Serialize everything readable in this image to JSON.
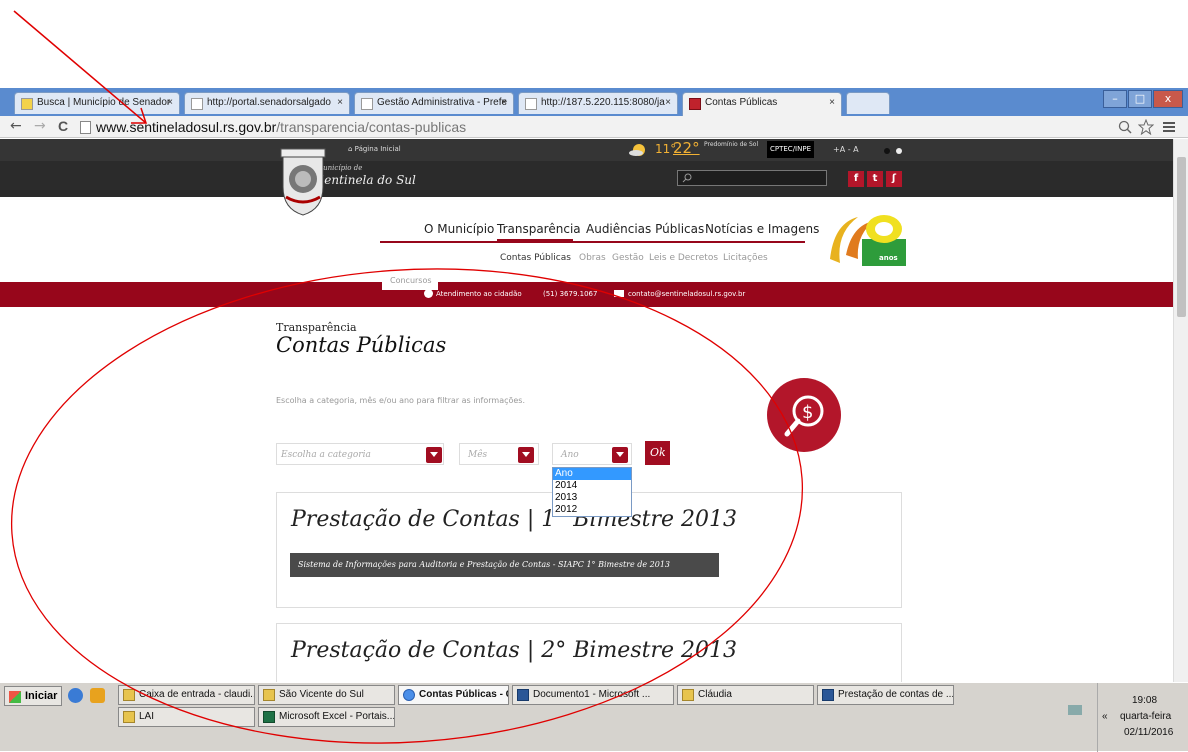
{
  "browser": {
    "tabs": [
      {
        "label": "Busca | Município de Senador",
        "active": false
      },
      {
        "label": "http://portal.senadorsalgado",
        "active": false
      },
      {
        "label": "Gestão Administrativa - Prefe",
        "active": false
      },
      {
        "label": "http://187.5.220.115:8080/ja",
        "active": false
      },
      {
        "label": "Contas Públicas",
        "active": true
      }
    ],
    "url_domain": "www.sentineladosul.rs.gov.br",
    "url_path": "/transparencia/contas-publicas",
    "tab_close": "×",
    "win_min": "–",
    "win_max": "□",
    "win_close": "x",
    "nav_back": "←",
    "nav_fwd": "→",
    "nav_reload": "C"
  },
  "site": {
    "home_link": "Página Inicial",
    "temp_low": "11°",
    "temp_high": "22°",
    "forecast": "Predomínio de Sol",
    "source": "CPTEC/INPE",
    "font_controls": "+A  - A",
    "municipio_small": "Município de",
    "municipio_name": "Sentinela do Sul",
    "social": [
      "f",
      "t",
      "ʃ"
    ],
    "nav": [
      "O Município",
      "Transparência",
      "Audiências Públicas",
      "Notícias e Imagens"
    ],
    "subnav": [
      "Contas Públicas",
      "Obras",
      "Gestão",
      "Leis e Decretos",
      "Licitações"
    ],
    "subnav_extra": "Concursos",
    "anos": "anos",
    "contact_label": "Atendimento ao cidadão",
    "contact_phone": "(51) 3679.1067",
    "contact_email": "contato@sentineladosul.rs.gov.br"
  },
  "page": {
    "breadcrumb": "Transparência",
    "title": "Contas Públicas",
    "instruction": "Escolha a categoria, mês e/ou ano para filtrar as informações.",
    "category_placeholder": "Escolha a categoria",
    "month_placeholder": "Mês",
    "year_placeholder": "Ano",
    "ok": "Ok",
    "year_options": [
      "Ano",
      "2014",
      "2013",
      "2012"
    ],
    "cards": [
      {
        "title": "Prestação de Contas | 1° Bimestre 2013",
        "button": "Sistema de Informações para Auditoria e Prestação de Contas - SIAPC 1° Bimestre de 2013"
      },
      {
        "title": "Prestação de Contas | 2° Bimestre 2013"
      }
    ]
  },
  "taskbar": {
    "start": "Iniciar",
    "row1": [
      "Caixa de entrada - claudi...",
      "São Vicente do Sul",
      "Contas Públicas - Goo...",
      "Documento1 - Microsoft ...",
      "Cláudia",
      "Prestação de contas de ..."
    ],
    "row2": [
      "LAI",
      "Microsoft Excel - Portais..."
    ],
    "clock_time": "19:08",
    "clock_day": "quarta-feira",
    "clock_date": "02/11/2016",
    "tray_chevron": "«"
  },
  "colors": {
    "brand_red": "#97061b",
    "annotation_red": "#e00000",
    "tab_blue": "#5a8bcf"
  },
  "icons": [
    "home-icon",
    "sun-icon",
    "search-icon",
    "facebook-icon",
    "twitter-icon",
    "rss-icon",
    "money-search-icon",
    "phone-icon",
    "mail-icon",
    "star-icon",
    "menu-icon",
    "zoom-icon"
  ]
}
